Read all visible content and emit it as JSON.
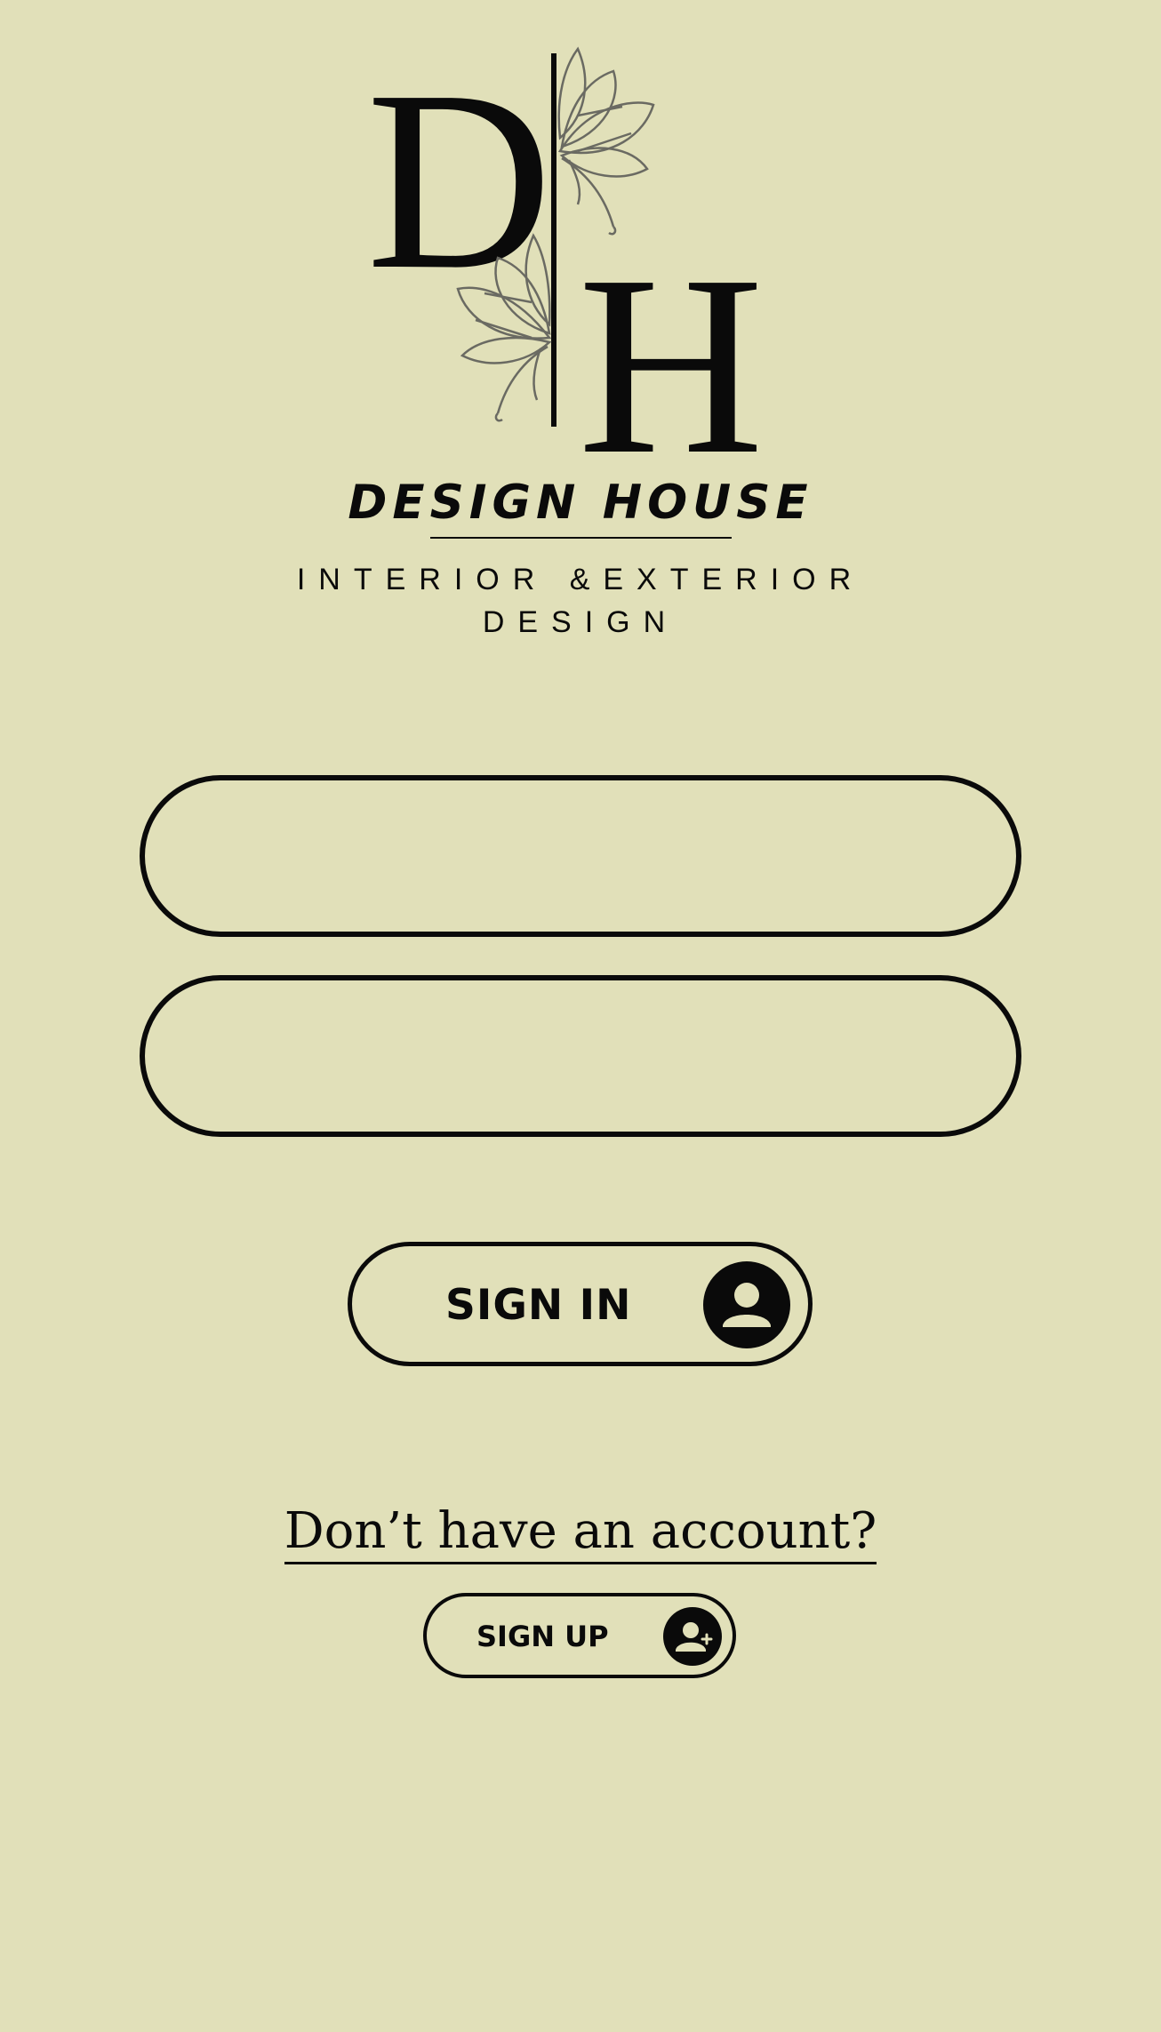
{
  "brand": {
    "monogram_left": "D",
    "monogram_right": "H",
    "title": "DESIGN HOUSE",
    "subtitle": "INTERIOR &EXTERIOR DESIGN"
  },
  "form": {
    "field_1": {
      "value": "",
      "placeholder": ""
    },
    "field_2": {
      "value": "",
      "placeholder": ""
    }
  },
  "signin": {
    "label": "SIGN IN",
    "icon": "user-icon"
  },
  "prompt": {
    "text": "Don’t have an account?"
  },
  "signup": {
    "label": "SIGN UP",
    "icon": "user-add-icon"
  },
  "colors": {
    "background": "#e1e0b9",
    "ink": "#0a0a0a",
    "leaf": "#6a6a62"
  }
}
